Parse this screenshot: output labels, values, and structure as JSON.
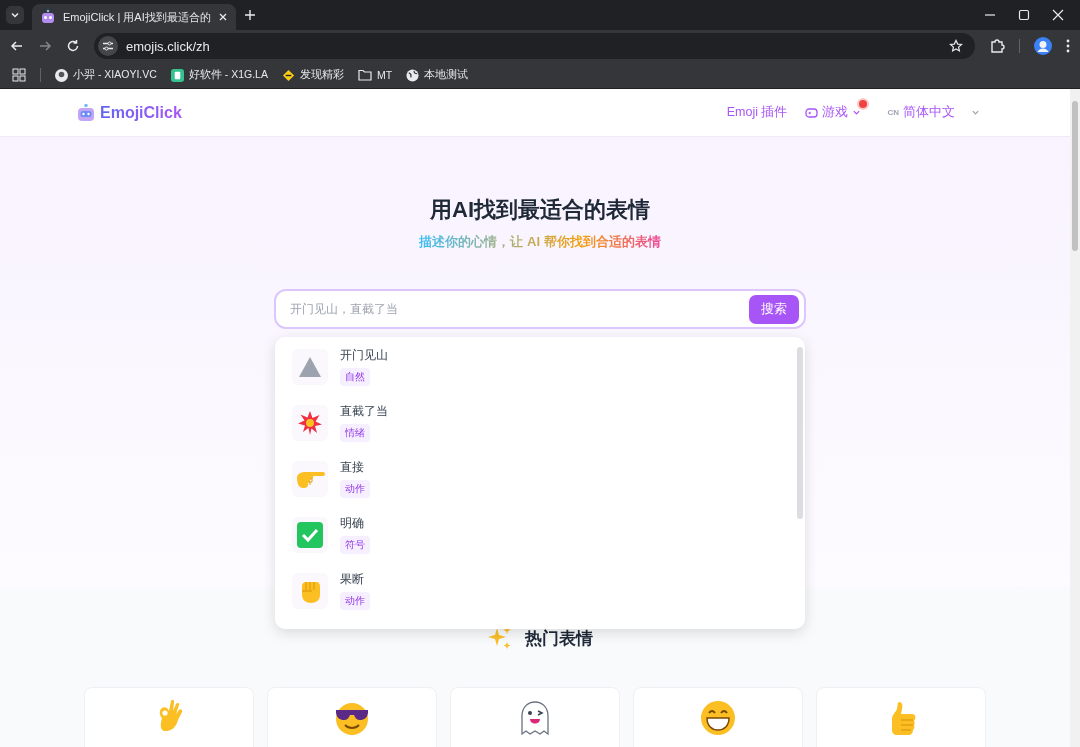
{
  "browser": {
    "tabs": [
      {
        "title": "EmojiClick | 用AI找到最适合的",
        "selected": true
      }
    ],
    "url": "emojis.click/zh",
    "bookmarks": [
      {
        "label": "小羿 - XIAOYI.VC",
        "kind": "avatar"
      },
      {
        "label": "好软件 - X1G.LA",
        "kind": "app"
      },
      {
        "label": "发现精彩",
        "kind": "spark"
      },
      {
        "label": "MT",
        "kind": "folder"
      },
      {
        "label": "本地测试",
        "kind": "globe"
      }
    ]
  },
  "header": {
    "logo": "EmojiClick",
    "nav": [
      {
        "label": "Emoji 插件",
        "kind": "link",
        "dot": false
      },
      {
        "label": "游戏",
        "kind": "menu",
        "dot": true
      },
      {
        "label": "简体中文",
        "kind": "language",
        "code": "CN",
        "dot": false
      }
    ]
  },
  "hero": {
    "title": "用AI找到最适合的表情",
    "subtitle": "描述你的心情，让 AI 帮你找到合适的表情",
    "search": {
      "placeholder": "开门见山，直截了当"
    },
    "button": "搜索"
  },
  "suggestions": [
    {
      "name": "开门见山",
      "category": "自然",
      "kind": "mountain"
    },
    {
      "name": "直截了当",
      "category": "情绪",
      "kind": "burst"
    },
    {
      "name": "直接",
      "category": "动作",
      "kind": "point"
    },
    {
      "name": "明确",
      "category": "符号",
      "kind": "check"
    },
    {
      "name": "果断",
      "category": "动作",
      "kind": "fist"
    }
  ],
  "popular": {
    "title": "热门表情",
    "cards": [
      {
        "kind": "ok"
      },
      {
        "kind": "cool"
      },
      {
        "kind": "ghost"
      },
      {
        "kind": "grin"
      },
      {
        "kind": "thumb"
      }
    ]
  }
}
